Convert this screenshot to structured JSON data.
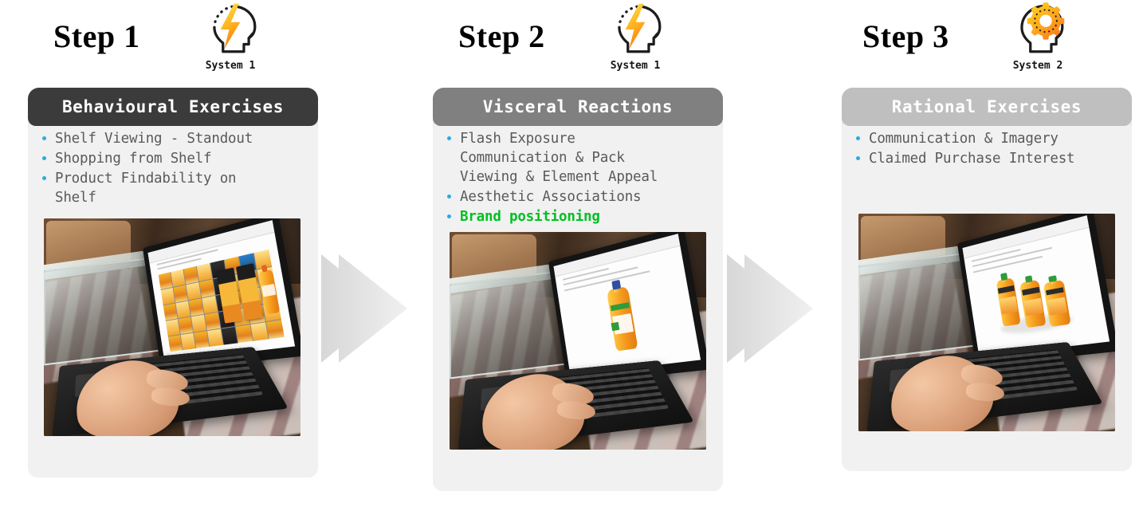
{
  "page": {
    "background": "#ffffff",
    "accent_bullet": "#29ABE2",
    "accent_green": "#00c021",
    "body_text": "#5a5a5a"
  },
  "steps": [
    {
      "title": "Step 1",
      "system": {
        "label": "System 1",
        "icon": "head-lightning-icon"
      },
      "card": {
        "header": "Behavioural Exercises",
        "header_color": "#3b3b3b",
        "body_color": "#f1f1f1",
        "shell_color": "#e8e8e8",
        "bullets": [
          {
            "text": "Shelf Viewing - Standout",
            "highlight": false
          },
          {
            "text": "Shopping from  Shelf",
            "highlight": false
          },
          {
            "text": "Product Findability on\nShelf",
            "highlight": false
          }
        ],
        "photo": {
          "alt": "Person using a Dell laptop on a glass coffee table showing an online shelf of orange juice packs",
          "screen_content": "retail-shelf-grid"
        }
      }
    },
    {
      "title": "Step 2",
      "system": {
        "label": "System 1",
        "icon": "head-lightning-icon"
      },
      "card": {
        "header": "Visceral Reactions",
        "header_color": "#808080",
        "body_color": "#f1f1f1",
        "shell_color": "#e8e8e8",
        "bullets": [
          {
            "text": "Flash Exposure\nCommunication & Pack\nViewing & Element Appeal",
            "highlight": false
          },
          {
            "text": "Aesthetic Associations",
            "highlight": false
          },
          {
            "text": "Brand positioning",
            "highlight": true
          }
        ],
        "photo": {
          "alt": "Person using a Dell laptop on a glass coffee table showing a single orange juice bottle",
          "screen_content": "single-bottle"
        }
      }
    },
    {
      "title": "Step 3",
      "system": {
        "label": "System 2",
        "icon": "head-gear-icon"
      },
      "card": {
        "header": "Rational Exercises",
        "header_color": "#bfbfbf",
        "body_color": "#f1f1f1",
        "shell_color": "#e8e8e8",
        "bullets": [
          {
            "text": "Communication & Imagery",
            "highlight": false
          },
          {
            "text": "Claimed Purchase Interest",
            "highlight": false
          }
        ],
        "photo": {
          "alt": "Person using a Dell laptop on a glass coffee table showing three orange juice bottles",
          "screen_content": "three-bottles"
        }
      }
    }
  ],
  "arrows": [
    {
      "name": "arrow-step1-to-step2",
      "color": "#e2e2e2",
      "direction": "right"
    },
    {
      "name": "arrow-step2-to-step3",
      "color": "#e2e2e2",
      "direction": "right"
    }
  ]
}
